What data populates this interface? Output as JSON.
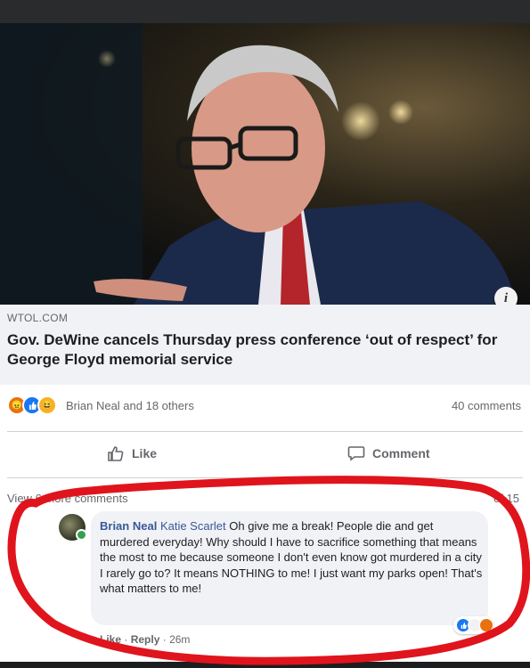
{
  "post": {
    "source": "WTOL.COM",
    "headline": "Gov. DeWine cancels Thursday press conference ‘out of respect’ for George Floyd memorial service",
    "info_icon": "i"
  },
  "reactions": {
    "icons": [
      "angry-icon",
      "like-icon",
      "haha-icon"
    ],
    "names": "Brian Neal and 18 others",
    "comments_count": "40 comments"
  },
  "actions": {
    "like_label": "Like",
    "comment_label": "Comment"
  },
  "comments_nav": {
    "view_more": "View 6 more comments",
    "page_count": "of 15"
  },
  "comment": {
    "author": "Brian Neal",
    "tagged_user": "Katie Scarlet",
    "text": "Oh give me a break! People die and get murdered everyday! Why should I have to sacrifice something that means the most to me because someone I don't even know got murdered in a city I rarely go to? It means NOTHING to me! I just want my parks open! That's what matters to me!",
    "like_label": "Like",
    "reply_label": "Reply",
    "separator": "·",
    "time": "26m"
  },
  "colors": {
    "annotation_circle": "#e0141c",
    "link_blue": "#385898",
    "like_blue": "#1877f2",
    "angry_orange": "#e9710f"
  }
}
